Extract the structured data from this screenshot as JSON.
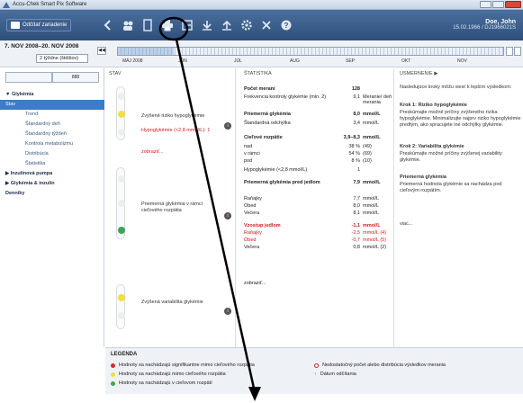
{
  "window": {
    "title": "Accu-Chek Smart Pix Software"
  },
  "toolbar": {
    "read_label": "Odčítať zariadenie",
    "user_name": "Doe, John",
    "user_detail": "15.02.1966 / DJ1966021S"
  },
  "nav": {
    "date_range": "7. NOV 2008–20. NOV 2008",
    "period": "2 týždne (štdišov)",
    "months": [
      "MÁJ 2008",
      "JÚN",
      "JÚL",
      "AUG",
      "SEP",
      "OKT",
      "NOV"
    ]
  },
  "sidebar": {
    "tabs": [
      "",
      "888"
    ],
    "items": [
      {
        "label": "▼ Glykémia",
        "type": "h"
      },
      {
        "label": "Stav",
        "type": "sel"
      },
      {
        "label": "Trend",
        "type": "sub"
      },
      {
        "label": "Štandardný deň",
        "type": "sub"
      },
      {
        "label": "Štandardný týždeň",
        "type": "sub"
      },
      {
        "label": "Kontrola metabolizmu",
        "type": "sub"
      },
      {
        "label": "Distribúcia",
        "type": "sub"
      },
      {
        "label": "Štatistika",
        "type": "sub"
      },
      {
        "label": "▶ Inzulínová pumpa",
        "type": "h"
      },
      {
        "label": "▶ Glykémia & inzulín",
        "type": "h"
      },
      {
        "label": "Denníky",
        "type": "h"
      }
    ]
  },
  "stav": {
    "header": "STAV",
    "block1": {
      "title": "Zvýšené riziko hypoglykémie",
      "alert": "Hypoglykémie (<2,8 mmol/L): 1",
      "link": "zobraziť..."
    },
    "block2": {
      "title": "Priemerná glykémia v rámci cieľového rozpätia"
    },
    "block3": {
      "title": "Zvýšená variabilita glykémie"
    }
  },
  "stat": {
    "header": "ŠTATISTIKA",
    "rows": [
      {
        "l": "Počet meraní",
        "v": "128",
        "u": "",
        "b": true
      },
      {
        "l": "Frekvencia kontroly glykémie (min. 2)",
        "v": "9,1",
        "u": "Meranie/ deň merania"
      },
      {
        "l": "Priemerná glykémia",
        "v": "8,0",
        "u": "mmol/L",
        "b": true
      },
      {
        "l": "Štandardná odchýlka",
        "v": "3,4",
        "u": "mmol/L"
      },
      {
        "l": "Cieľové rozpätie",
        "v": "3,9–8,3",
        "u": "mmol/L",
        "b": true
      },
      {
        "l": "  nad",
        "v": "38 %",
        "u": "(49)"
      },
      {
        "l": "  v rámci",
        "v": "54 %",
        "u": "(69)"
      },
      {
        "l": "  pod",
        "v": "8 %",
        "u": "(10)"
      },
      {
        "l": "Hypoglykémie (<2,8 mmol/L)",
        "v": "1",
        "u": ""
      },
      {
        "l": "Priemerná glykémia pred jedlom",
        "v": "7,9",
        "u": "mmol/L",
        "b": true
      },
      {
        "l": "  Raňajky",
        "v": "7,7",
        "u": "mmol/L"
      },
      {
        "l": "  Obed",
        "v": "8,0",
        "u": "mmol/L"
      },
      {
        "l": "  Večera",
        "v": "8,1",
        "u": "mmol/L"
      },
      {
        "l": "Vzostup jedlom",
        "v": "-1,1",
        "u": "mmol/L",
        "b": true,
        "red": true
      },
      {
        "l": "  Raňajky",
        "v": "-2,5",
        "u": "mmol/L (4)",
        "red": true
      },
      {
        "l": "  Obed",
        "v": "-0,7",
        "u": "mmol/L (5)",
        "red": true
      },
      {
        "l": "  Večera",
        "v": "0,8",
        "u": "mmol/L (2)"
      }
    ],
    "link": "zobraziť..."
  },
  "usm": {
    "header": "USMERNENIE ▶",
    "intro": "Nasledujúce kroky môžu viesť k lepším výsledkom:",
    "k1": "Krok 1: Riziko hypoglykémie",
    "k1t": "Preskúmajte možné príčiny zvýšeného rizika hypoglykémie. Minimalizujte najprv riziko hypoglykémie predtým, ako spracujete iné odchýlky glykémie.",
    "k2": "Krok 2: Variabilita glykémie",
    "k2t": "Preskúmajte možné príčiny zvýšenej variability glykémie.",
    "pg": "Priemerná glykémia",
    "pgt": "Priemerná hodnota glykémie sa nachádza pod cieľovým rozpätím.",
    "more": "viac..."
  },
  "legend": {
    "title": "LEGENDA",
    "r1": "Hodnoty sa nachádzajú signifikantne mimo cieľového rozpätia",
    "r2": "Hodnoty sa nachádzajú mimo cieľového rozpätia",
    "r3": "Hodnoty sa nachádzajú v cieľovom rozpätí",
    "r4": "Nedostatočný počet alebo distribúcia výsledkov merania",
    "r5": "Dátum odčítania"
  },
  "colors": {
    "red": "#d42a2a",
    "yellow": "#f0e040",
    "green": "#3fa35b",
    "annot": "#000000"
  }
}
